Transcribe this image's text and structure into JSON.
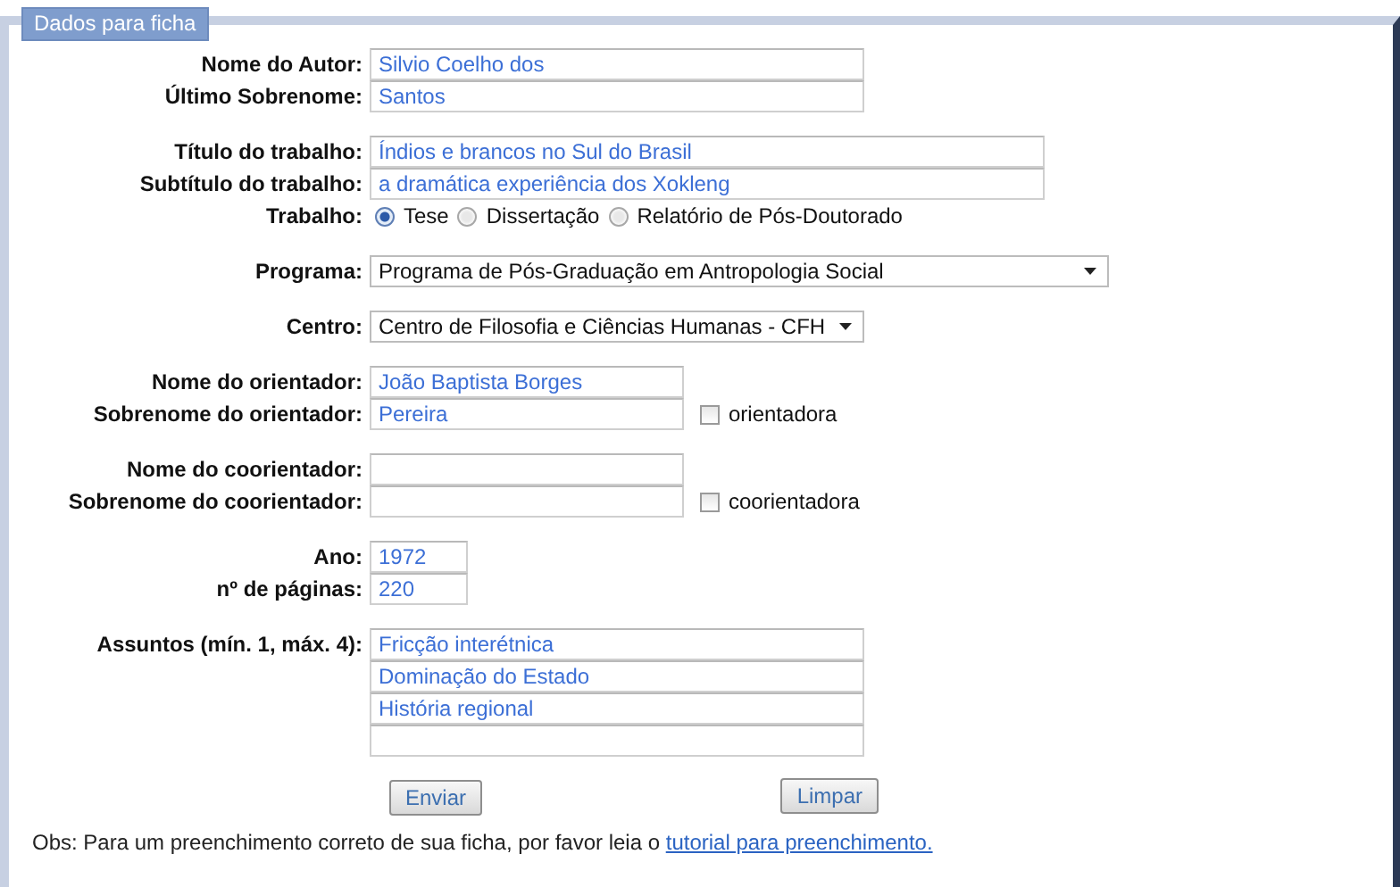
{
  "legend": "Dados para ficha",
  "groups": [
    [
      {
        "kind": "text",
        "label": "Nome do Autor:",
        "value": "Silvio Coelho dos"
      },
      {
        "kind": "text",
        "label": "Último Sobrenome:",
        "value": "Santos"
      }
    ],
    [
      {
        "kind": "text",
        "label": "Título do trabalho:",
        "value": "Índios e brancos no Sul do Brasil"
      },
      {
        "kind": "text",
        "label": "Subtítulo do trabalho:",
        "value": "a dramática experiência dos Xokleng"
      },
      {
        "kind": "radio",
        "label": "Trabalho:",
        "options": [
          {
            "label": "Tese",
            "selected": true
          },
          {
            "label": "Dissertação",
            "selected": false
          },
          {
            "label": "Relatório de Pós-Doutorado",
            "selected": false
          }
        ]
      }
    ],
    [
      {
        "kind": "select",
        "label": "Programa:",
        "value": "Programa de Pós-Graduação em Antropologia Social"
      }
    ],
    [
      {
        "kind": "select",
        "label": "Centro:",
        "value": "Centro de Filosofia e Ciências Humanas - CFH"
      }
    ],
    [
      {
        "kind": "text",
        "label": "Nome do orientador:",
        "value": "João Baptista Borges"
      },
      {
        "kind": "text",
        "label": "Sobrenome do orientador:",
        "value": "Pereira",
        "checkbox": {
          "label": "orientadora",
          "checked": false
        }
      }
    ],
    [
      {
        "kind": "text",
        "label": "Nome do coorientador:"
      },
      {
        "kind": "text",
        "label": "Sobrenome do coorientador:",
        "checkbox": {
          "label": "coorientadora",
          "checked": false
        }
      }
    ],
    [
      {
        "kind": "text",
        "label": "Ano:",
        "value": "1972"
      },
      {
        "kind": "text",
        "label": "nº de páginas:",
        "value": "220"
      }
    ],
    [
      {
        "kind": "multi",
        "label": "Assuntos (mín. 1, máx. 4):",
        "values": [
          "Fricção interétnica",
          "Dominação do Estado",
          "História regional"
        ]
      }
    ]
  ],
  "buttons": [
    "Enviar",
    "Limpar"
  ],
  "note": {
    "text": "Obs: Para um preenchimento correto de sua ficha, por favor leia o",
    "link": "tutorial para preenchimento."
  }
}
